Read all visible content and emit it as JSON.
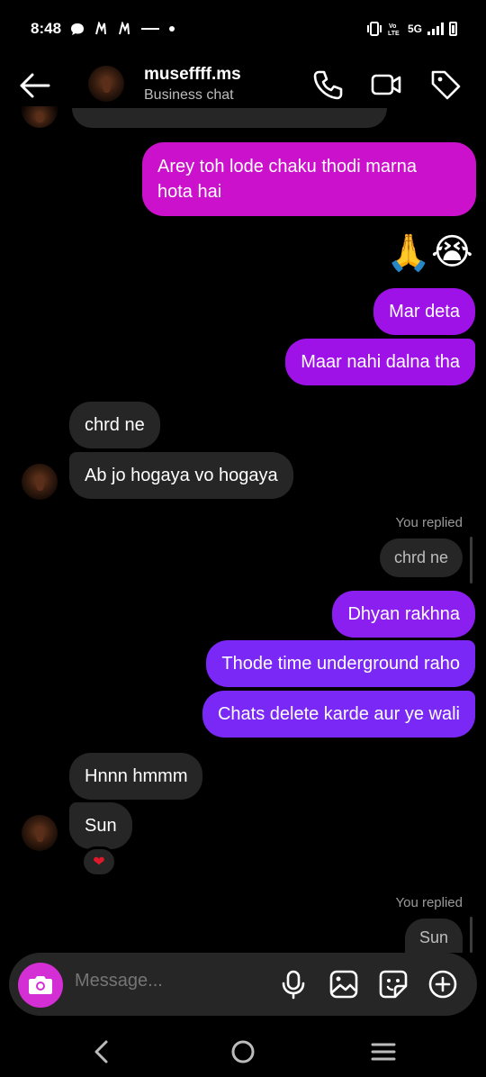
{
  "status_bar": {
    "time": "8:48",
    "network": "5G"
  },
  "header": {
    "username": "museffff.ms",
    "subtitle": "Business chat"
  },
  "messages": {
    "m1": "Arey toh lode chaku thodi marna",
    "m1b": "hota hai",
    "emojis": [
      "🙏",
      "😭"
    ],
    "m2": "Mar deta",
    "m3": "Maar nahi dalna tha",
    "m4": "chrd ne",
    "m5": "Ab jo hogaya vo hogaya",
    "replied_label_1": "You replied",
    "reply_quote_1": "chrd ne",
    "m6": "Dhyan rakhna",
    "m7": "Thode time underground raho",
    "m8": "Chats delete karde aur ye wali",
    "m9": "Hnnn hmmm",
    "m10": "Sun",
    "reaction": "❤",
    "replied_label_2": "You replied",
    "reply_quote_2": "Sun"
  },
  "composer": {
    "placeholder": "Message..."
  },
  "colors": {
    "accent_pink": "#cc11cc",
    "accent_purple": "#7a28f5",
    "incoming_bubble": "#262626"
  },
  "icons": {
    "header": [
      "back-arrow-icon",
      "phone-icon",
      "video-icon",
      "tag-icon"
    ],
    "composer": [
      "camera-icon",
      "mic-icon",
      "gallery-icon",
      "sticker-icon",
      "plus-icon"
    ],
    "nav": [
      "nav-back-icon",
      "nav-home-icon",
      "nav-recents-icon"
    ]
  }
}
